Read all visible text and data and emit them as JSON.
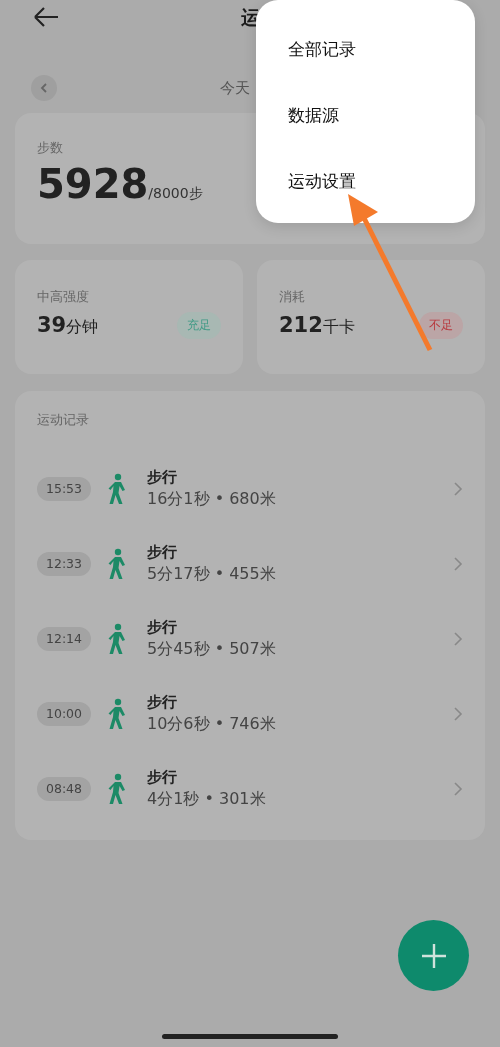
{
  "header": {
    "title": "运"
  },
  "date_bar": {
    "label": "今天"
  },
  "steps": {
    "label": "步数",
    "value": "5928",
    "goal": "/8000步"
  },
  "metrics": [
    {
      "label": "中高强度",
      "value": "39",
      "unit": "分钟",
      "badge": "充足",
      "kind": "good"
    },
    {
      "label": "消耗",
      "value": "212",
      "unit": "千卡",
      "badge": "不足",
      "kind": "poor"
    }
  ],
  "records": {
    "title": "运动记录",
    "items": [
      {
        "time": "15:53",
        "name": "步行",
        "detail": "16分1秒 • 680米"
      },
      {
        "time": "12:33",
        "name": "步行",
        "detail": "5分17秒 • 455米"
      },
      {
        "time": "12:14",
        "name": "步行",
        "detail": "5分45秒 • 507米"
      },
      {
        "time": "10:00",
        "name": "步行",
        "detail": "10分6秒 • 746米"
      },
      {
        "time": "08:48",
        "name": "步行",
        "detail": "4分1秒 • 301米"
      }
    ]
  },
  "menu": {
    "items": [
      "全部记录",
      "数据源",
      "运动设置"
    ]
  }
}
